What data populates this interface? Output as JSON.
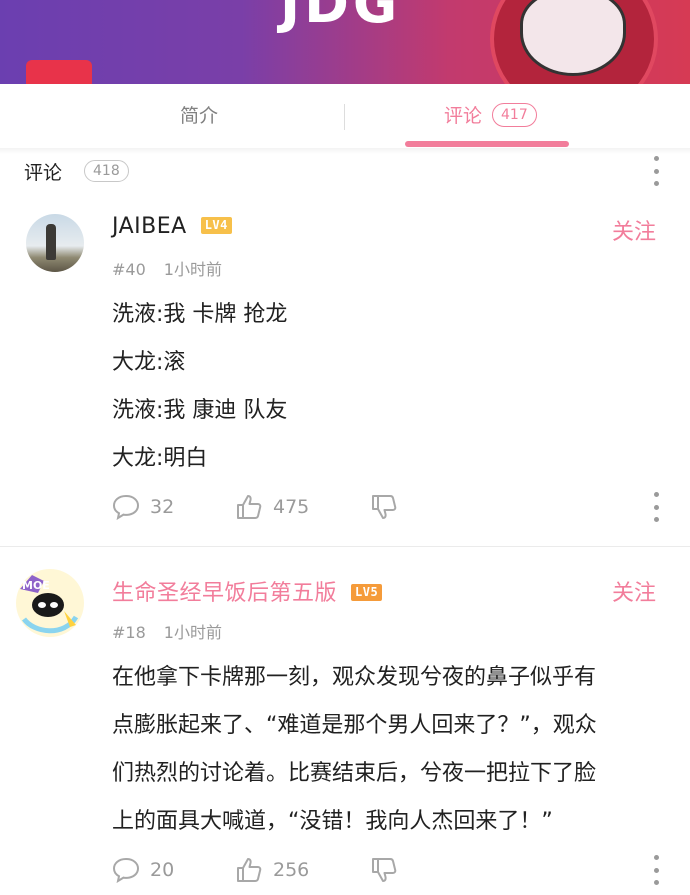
{
  "banner": {
    "logo_text": "JDG"
  },
  "tabs": {
    "intro_label": "简介",
    "comments_label": "评论",
    "comments_count": "417"
  },
  "comments_header": {
    "title": "评论",
    "count": "418"
  },
  "comments": [
    {
      "username": "JAIBEA",
      "level": "LV4",
      "follow_label": "关注",
      "floor": "#40",
      "time": "1小时前",
      "lines": [
        "洗液:我 卡牌 抢龙",
        "大龙:滚",
        "洗液:我 康迪 队友",
        "大龙:明白"
      ],
      "reply_count": "32",
      "like_count": "475"
    },
    {
      "username": "生命圣经早饭后第五版",
      "level": "LV5",
      "follow_label": "关注",
      "floor": "#18",
      "time": "1小时前",
      "lines": [
        "在他拿下卡牌那一刻，观众发现兮夜的鼻子似乎有",
        "点膨胀起来了、“难道是那个男人回来了？”，观众",
        "们热烈的讨论着。比赛结束后，兮夜一把拉下了脸",
        "上的面具大喊道，“没错！我向人杰回来了！”"
      ],
      "reply_count": "20",
      "like_count": "256"
    }
  ],
  "colors": {
    "accent": "#f27d9b",
    "muted": "#9a9a9a",
    "text": "#212121"
  }
}
